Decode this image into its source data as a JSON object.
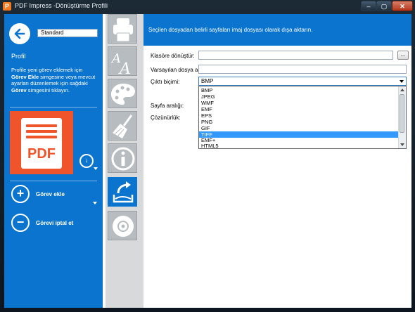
{
  "window": {
    "title": "PDF Impress -Dönüştürme Profili",
    "app_icon": "pdf-impress-logo",
    "controls": {
      "minimize": "minimize-icon",
      "maximize": "maximize-icon",
      "close": "close-icon"
    }
  },
  "sidebar": {
    "profile_name": "Standard",
    "section_title": "Profil",
    "description": {
      "line1": "Profile yeni görev eklemek için",
      "line2_bold": "Görev Ekle",
      "line2_rest": " simgesine veya mevcut",
      "line3": "ayarları düzenlemek için sağdaki",
      "line4_bold": "Görev",
      "line4_rest": " simgesini tıklayın."
    },
    "output_badge": "PDF",
    "add_task_label": "Görev ekle",
    "remove_task_label": "Görevi iptal et"
  },
  "toolbar": {
    "tools": [
      "printer-icon",
      "fonts-icon",
      "palette-icon",
      "broom-icon",
      "info-icon",
      "export-image-icon",
      "disc-icon"
    ],
    "active_tool": "export-image-icon"
  },
  "panel": {
    "header": "Seçilen dosyadan belirli sayfaları imaj dosyası olarak dışa aktarın.",
    "fields": {
      "folder_label": "Klasöre dönüştür:",
      "folder_value": "",
      "browse_label": "...",
      "filename_label": "Varsayılan dosya adı:",
      "filename_value": "",
      "format_label": "Çıktı biçimi:",
      "format_value": "BMP",
      "page_range_label": "Sayfa aralığı:",
      "resolution_label": "Çözünürlük:"
    },
    "format_options": [
      "BMP",
      "JPEG",
      "WMF",
      "EMF",
      "EPS",
      "PNG",
      "GIF",
      "TIFF",
      "EMF+",
      "HTML5"
    ],
    "highlighted_option": "TIFF"
  },
  "colors": {
    "accent": "#0A74CF",
    "pdf_orange": "#F0542A",
    "selection": "#3399FF"
  }
}
